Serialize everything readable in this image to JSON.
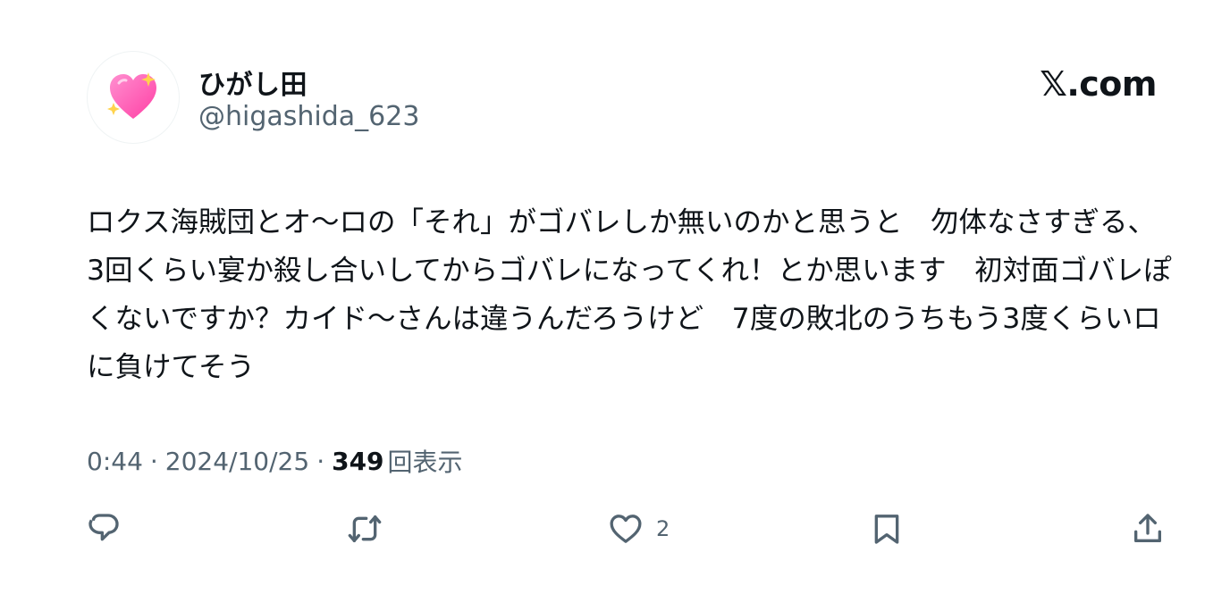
{
  "author": {
    "display_name": "ひがし田",
    "handle": "@higashida_623",
    "avatar_icon": "sparkling-heart-icon"
  },
  "site_logo": "𝕏.com",
  "tweet": {
    "text": "ロクス海賊団とオ〜ロの「それ」がゴバレしか無いのかと思うと　勿体なさすぎる、3回くらい宴か殺し合いしてからゴバレになってくれ！とか思います　初対面ゴバレぽくないですか？カイド〜さんは違うんだろうけど　7度の敗北のうちもう3度くらいロに負けてそう"
  },
  "meta": {
    "time": "0:44",
    "separator": "·",
    "date": "2024/10/25",
    "views_count": "349",
    "views_label": "回表示"
  },
  "actions": {
    "reply_icon": "reply-icon",
    "retweet_icon": "retweet-icon",
    "like_icon": "heart-icon",
    "like_count": "2",
    "bookmark_icon": "bookmark-icon",
    "share_icon": "share-icon"
  },
  "colors": {
    "text_primary": "#0f1419",
    "text_secondary": "#536471",
    "heart_pink": "#ff5fb0"
  }
}
